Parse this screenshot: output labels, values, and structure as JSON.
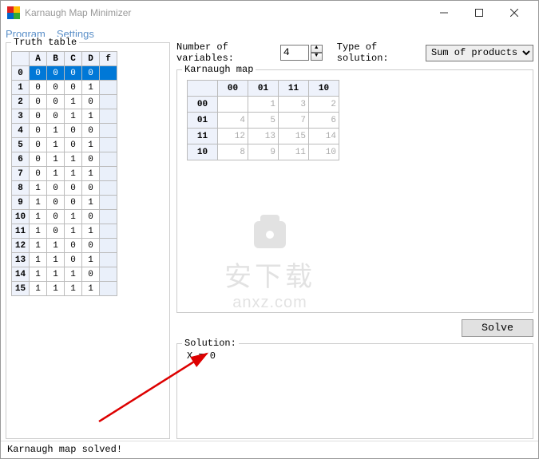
{
  "window": {
    "title": "Karnaugh Map Minimizer"
  },
  "menu": {
    "program": "Program",
    "settings": "Settings"
  },
  "truth_table": {
    "legend": "Truth table",
    "headers": [
      "",
      "A",
      "B",
      "C",
      "D",
      "f"
    ],
    "rows": [
      [
        "0",
        "0",
        "0",
        "0",
        "0",
        ""
      ],
      [
        "1",
        "0",
        "0",
        "0",
        "1",
        ""
      ],
      [
        "2",
        "0",
        "0",
        "1",
        "0",
        ""
      ],
      [
        "3",
        "0",
        "0",
        "1",
        "1",
        ""
      ],
      [
        "4",
        "0",
        "1",
        "0",
        "0",
        ""
      ],
      [
        "5",
        "0",
        "1",
        "0",
        "1",
        ""
      ],
      [
        "6",
        "0",
        "1",
        "1",
        "0",
        ""
      ],
      [
        "7",
        "0",
        "1",
        "1",
        "1",
        ""
      ],
      [
        "8",
        "1",
        "0",
        "0",
        "0",
        ""
      ],
      [
        "9",
        "1",
        "0",
        "0",
        "1",
        ""
      ],
      [
        "10",
        "1",
        "0",
        "1",
        "0",
        ""
      ],
      [
        "11",
        "1",
        "0",
        "1",
        "1",
        ""
      ],
      [
        "12",
        "1",
        "1",
        "0",
        "0",
        ""
      ],
      [
        "13",
        "1",
        "1",
        "0",
        "1",
        ""
      ],
      [
        "14",
        "1",
        "1",
        "1",
        "0",
        ""
      ],
      [
        "15",
        "1",
        "1",
        "1",
        "1",
        ""
      ]
    ],
    "selected_row": 0
  },
  "controls": {
    "num_vars_label": "Number of variables:",
    "num_vars_value": "4",
    "type_label": "Type of solution:",
    "type_value": "Sum of products"
  },
  "kmap": {
    "legend": "Karnaugh map",
    "col_headers": [
      "",
      "00",
      "01",
      "11",
      "10"
    ],
    "rows": [
      [
        "00",
        "",
        "1",
        "3",
        "2"
      ],
      [
        "01",
        "4",
        "5",
        "7",
        "6"
      ],
      [
        "11",
        "12",
        "13",
        "15",
        "14"
      ],
      [
        "10",
        "8",
        "9",
        "11",
        "10"
      ]
    ]
  },
  "solve_button": "Solve",
  "solution": {
    "legend": "Solution:",
    "text": "X = 0"
  },
  "status": "Karnaugh map solved!",
  "watermark": {
    "cn": "安下载",
    "en": "anxz.com"
  }
}
